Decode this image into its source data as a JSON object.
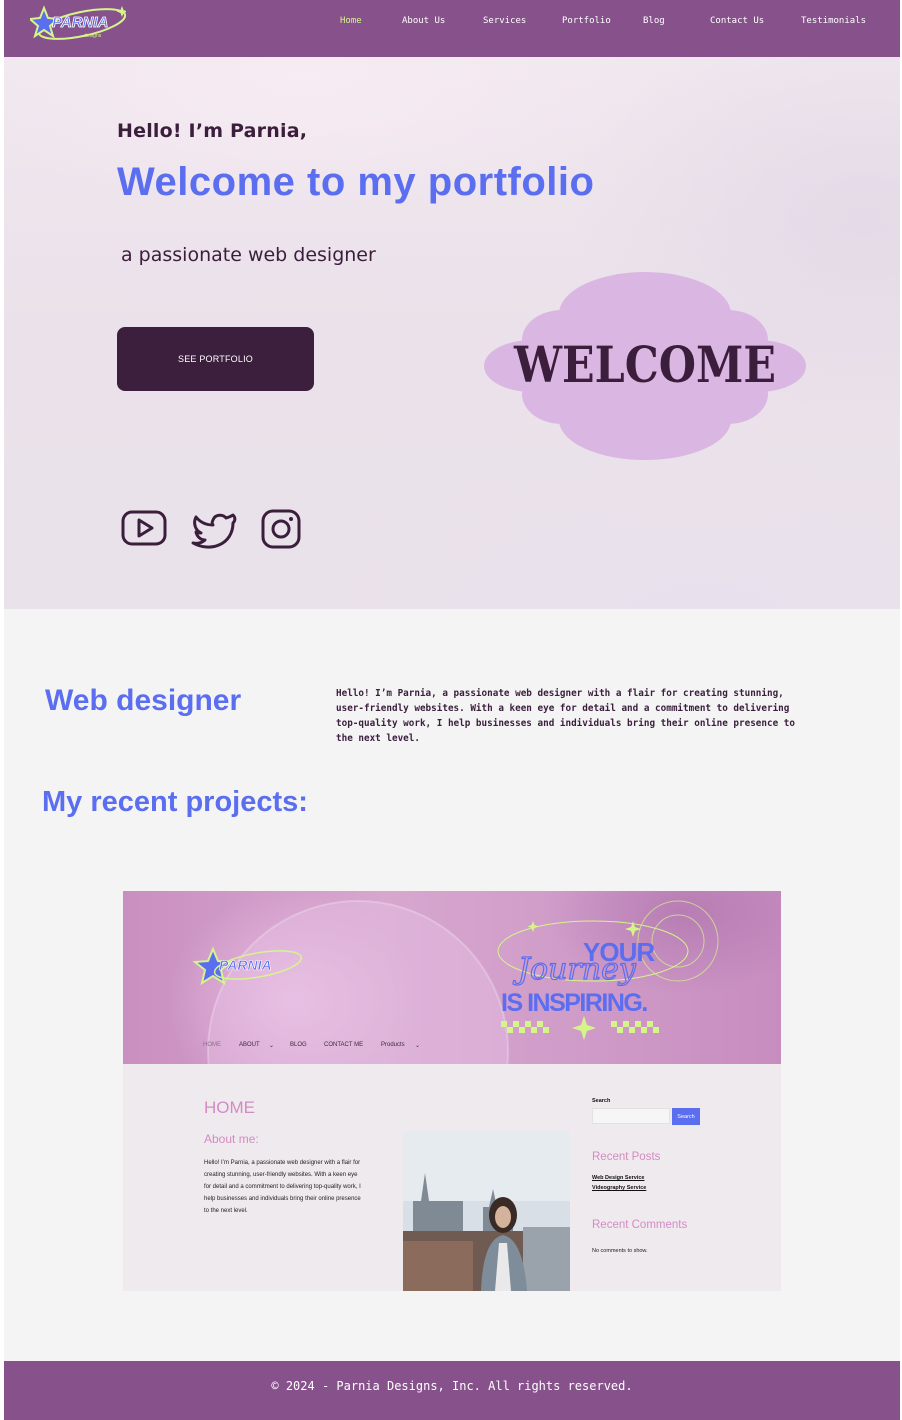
{
  "header": {
    "logo_text": "PARNIA",
    "nav": [
      "Home",
      "About Us",
      "Services",
      "Portfolio",
      "Blog",
      "Contact Us",
      "Testimonials"
    ],
    "active": "Home"
  },
  "hero": {
    "greeting": "Hello! I’m Parnia,",
    "title": "Welcome to my portfolio",
    "tagline": "a passionate web designer",
    "cta": "SEE PORTFOLIO",
    "badge": "WELCOME",
    "social": [
      "youtube-icon",
      "twitter-icon",
      "instagram-icon"
    ]
  },
  "about": {
    "role": "Web designer",
    "text": "Hello! I’m Parnia, a passionate web designer with a flair for creating stunning, user-friendly websites. With a keen eye for detail and a commitment to delivering top-quality work, I help businesses and individuals bring their online presence to the next level."
  },
  "projects": {
    "title": "My recent projects:",
    "preview": {
      "logo_text": "PARNIA",
      "banner_text": [
        "YOUR",
        "Journey",
        "IS INSPIRING."
      ],
      "nav": [
        "HOME",
        "ABOUT",
        "BLOG",
        "CONTACT ME",
        "Products"
      ],
      "heading": "HOME",
      "subheading": "About me:",
      "body": "Hello! I’m Parnia, a passionate web designer with a flair for creating stunning, user-friendly websites. With a keen eye for detail and a commitment to delivering top-quality work, I help businesses and individuals bring their online presence to the next level.",
      "search_label": "Search",
      "search_button": "Search",
      "recent_posts": "Recent Posts",
      "posts": [
        "Web Design Service",
        "Videography Service"
      ],
      "recent_comments": "Recent Comments",
      "no_comments": "No comments to show."
    }
  },
  "footer": {
    "copyright": "© 2024 - Parnia Designs, Inc. All rights reserved."
  },
  "colors": {
    "header": "#87528c",
    "accent_blue": "#5b6ef0",
    "dark_plum": "#3c1f3d",
    "lavender": "#dab7e2",
    "nav_active": "#d5f58a"
  }
}
